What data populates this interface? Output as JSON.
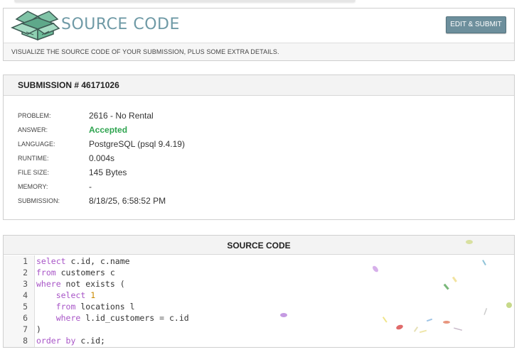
{
  "header": {
    "title": "SOURCE CODE",
    "edit_button_label": "EDIT & SUBMIT",
    "description": "VISUALIZE THE SOURCE CODE OF YOUR SUBMISSION, PLUS SOME EXTRA DETAILS."
  },
  "submission": {
    "heading": "SUBMISSION # 46171026",
    "fields": [
      {
        "label": "PROBLEM:",
        "value": "2616 - No Rental"
      },
      {
        "label": "ANSWER:",
        "value": "Accepted"
      },
      {
        "label": "LANGUAGE:",
        "value": "PostgreSQL (psql 9.4.19)"
      },
      {
        "label": "RUNTIME:",
        "value": "0.004s"
      },
      {
        "label": "FILE SIZE:",
        "value": "145 Bytes"
      },
      {
        "label": "MEMORY:",
        "value": "-"
      },
      {
        "label": "SUBMISSION:",
        "value": "8/18/25, 6:58:52 PM"
      }
    ]
  },
  "source": {
    "heading": "SOURCE CODE",
    "line_numbers": [
      "1",
      "2",
      "3",
      "4",
      "5",
      "6",
      "7",
      "8"
    ],
    "lines": [
      {
        "kw1": "select",
        "text": " c.id, c.name"
      },
      {
        "kw1": "from",
        "text": " customers c"
      },
      {
        "kw1": "where",
        "text": " not exists ("
      },
      {
        "indent": "    ",
        "kw1": "select",
        "sp": " ",
        "num": "1"
      },
      {
        "indent": "    ",
        "kw1": "from",
        "text": " locations l"
      },
      {
        "indent": "    ",
        "kw1": "where",
        "text": " l.id_customers ",
        "op": "=",
        "text2": " c.id"
      },
      {
        "text": ")"
      },
      {
        "kw1": "order by",
        "text": " c.id;"
      }
    ]
  },
  "colors": {
    "title": "#6f9aa6",
    "button": "#6d8f9c",
    "accepted": "#2ea44f",
    "keyword": "#a855c7",
    "number": "#c98a00"
  },
  "icons": {
    "logo": "open-box-logo-icon"
  }
}
